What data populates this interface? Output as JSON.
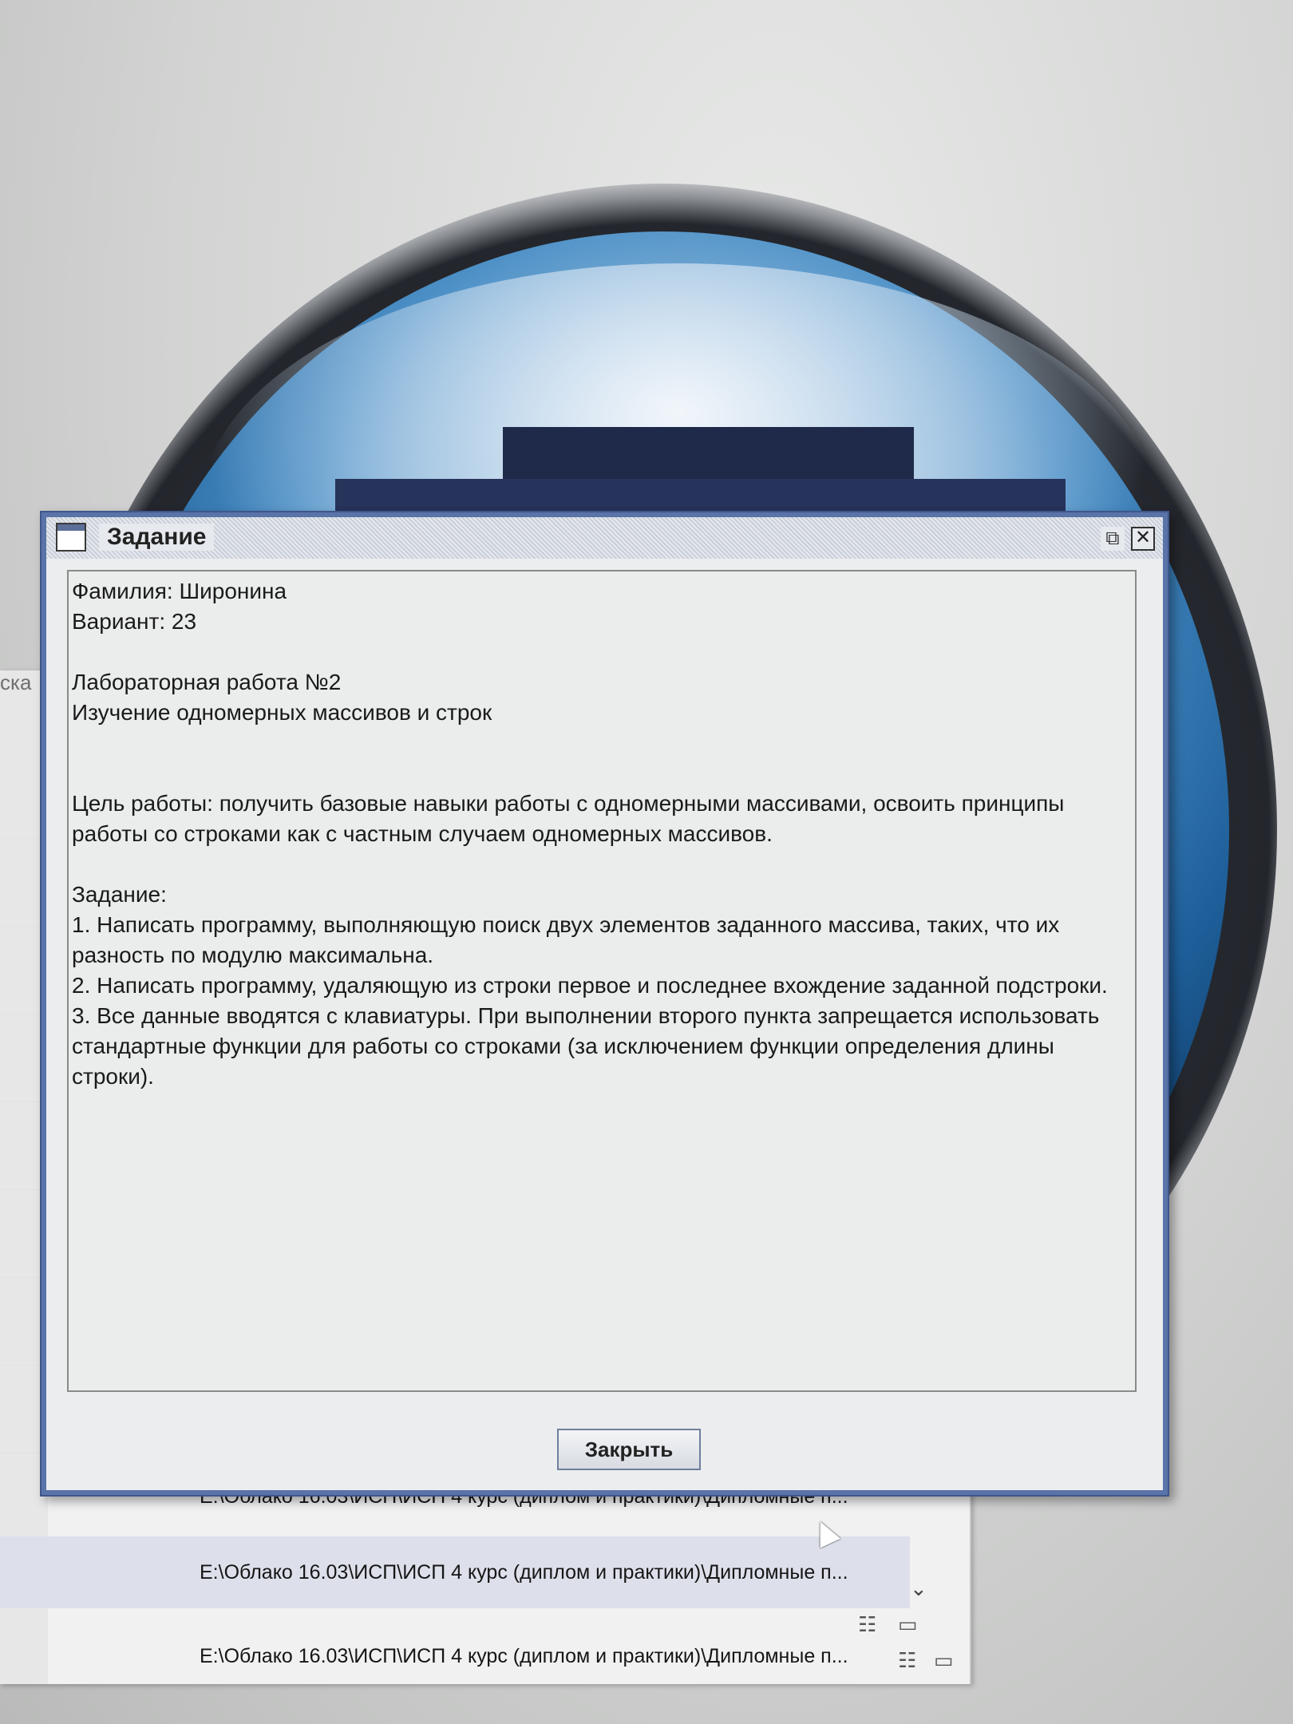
{
  "background_window": {
    "side_label": "ска",
    "path_rows": [
      "E:\\Облако 16.03\\ИСП\\ИСП 4 курс (диплом и практики)\\Дипломные п...",
      "E:\\Облако 16.03\\ИСП\\ИСП 4 курс (диплом и практики)\\Дипломные п...",
      "E:\\Облако 16.03\\ИСП\\ИСП 4 курс (диплом и практики)\\Дипломные п..."
    ]
  },
  "dialog": {
    "title": "Задание",
    "close_button_label": "Закрыть",
    "content": {
      "surname": "Фамилия: Широнина",
      "variant": "Вариант: 23",
      "lab_title": "Лабораторная работа №2",
      "lab_subtitle": "Изучение одномерных массивов и строк",
      "goal": "Цель работы: получить базовые навыки работы с одномерными массивами, освоить принципы работы со строками как с частным случаем одномерных массивов.",
      "task_heading": "Задание:",
      "task_1": "1. Написать программу, выполняющую поиск двух элементов заданного массива, таких, что их разность по модулю максимальна.",
      "task_2": "2. Написать программу, удаляющую из строки первое и последнее вхождение заданной подстроки.",
      "task_3": "3. Все данные вводятся с клавиатуры. При выполнении второго пункта запрещается использовать стандартные функции для работы со строками (за исключением функции определения длины строки)."
    }
  }
}
